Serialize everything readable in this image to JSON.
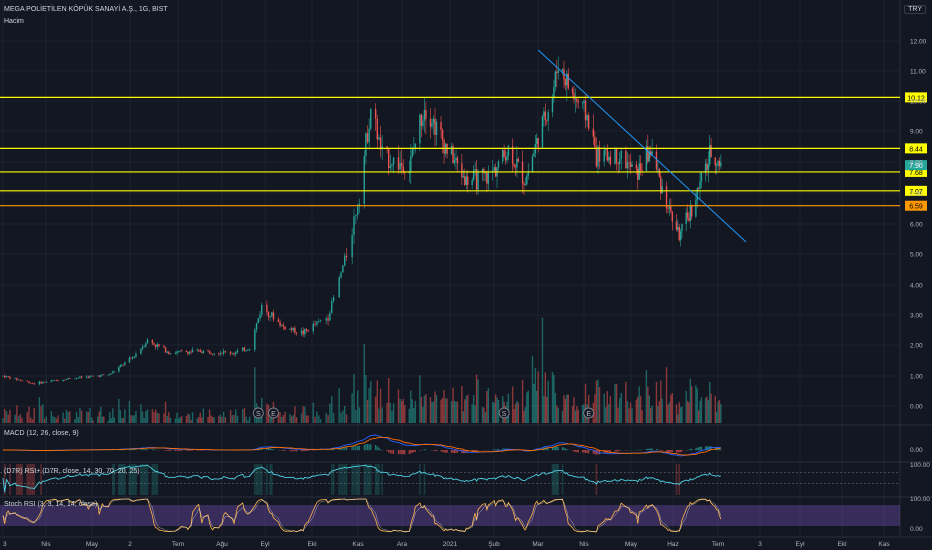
{
  "header": {
    "title": "MEGA POLİETİLEN KÖPÜK SANAYİ A.Ş., 1G, BIST",
    "volume_label": "Hacim",
    "currency": "TRY"
  },
  "colors": {
    "background": "#131722",
    "grid": "#1e222d",
    "up": "#26a69a",
    "down": "#ef5350",
    "level_yellow": "#ffff00",
    "level_orange": "#ff9800",
    "trendline": "#2196f3",
    "macd": "#2962ff",
    "signal": "#ff6d00",
    "stoch_k": "#ffb74d",
    "stoch_band": "#7e57c2"
  },
  "chart_data": {
    "type": "candlestick",
    "x_ticks": [
      "3",
      "Nis",
      "May",
      "2",
      "Tem",
      "Ağu",
      "Eyl",
      "Ekl",
      "Kas",
      "Ara",
      "2021",
      "Şub",
      "Mar",
      "Nis",
      "May",
      "Haz",
      "Tem",
      "3",
      "Eyl",
      "Ekl",
      "Kas"
    ],
    "y_ticks": [
      "12.00",
      "11.00",
      "10.00",
      "9.00",
      "8.00",
      "7.00",
      "6.00",
      "5.00",
      "4.00",
      "3.00",
      "2.00",
      "1.00",
      "0.00"
    ],
    "price_levels": [
      {
        "label": "10.12",
        "value": 10.12,
        "color": "#ffff00"
      },
      {
        "label": "8.44",
        "value": 8.44,
        "color": "#ffff00"
      },
      {
        "label": "7.68",
        "value": 7.68,
        "color": "#ffff00"
      },
      {
        "label": "7.07",
        "value": 7.07,
        "color": "#ffff00"
      },
      {
        "label": "6.59",
        "value": 6.59,
        "color": "#ff9800"
      }
    ],
    "last_price": {
      "label": "7.90",
      "value": 7.9
    },
    "trendline": {
      "from": {
        "date": "2021-01-29",
        "price": 11.7
      },
      "to": {
        "date": "2021-06-22",
        "price": 5.4
      }
    },
    "event_markers": [
      {
        "label": "S",
        "date": "2020-08-05"
      },
      {
        "label": "E",
        "date": "2020-08-14"
      },
      {
        "label": "S",
        "date": "2021-01-05"
      },
      {
        "label": "E",
        "date": "2021-03-05"
      }
    ],
    "price_path": [
      {
        "date": "2020-03-02",
        "price": 1.0
      },
      {
        "date": "2020-03-20",
        "price": 0.75
      },
      {
        "date": "2020-04-10",
        "price": 0.92
      },
      {
        "date": "2020-05-05",
        "price": 1.05
      },
      {
        "date": "2020-05-20",
        "price": 1.6
      },
      {
        "date": "2020-05-29",
        "price": 2.15
      },
      {
        "date": "2020-06-12",
        "price": 1.75
      },
      {
        "date": "2020-07-01",
        "price": 1.8
      },
      {
        "date": "2020-07-22",
        "price": 1.75
      },
      {
        "date": "2020-07-31",
        "price": 1.9
      },
      {
        "date": "2020-08-07",
        "price": 3.3
      },
      {
        "date": "2020-08-20",
        "price": 2.6
      },
      {
        "date": "2020-09-01",
        "price": 2.4
      },
      {
        "date": "2020-09-15",
        "price": 2.95
      },
      {
        "date": "2020-09-25",
        "price": 5.0
      },
      {
        "date": "2020-10-02",
        "price": 7.0
      },
      {
        "date": "2020-10-09",
        "price": 9.8
      },
      {
        "date": "2020-10-16",
        "price": 8.2
      },
      {
        "date": "2020-11-02",
        "price": 7.8
      },
      {
        "date": "2020-11-12",
        "price": 9.9
      },
      {
        "date": "2020-11-25",
        "price": 8.6
      },
      {
        "date": "2020-12-10",
        "price": 7.4
      },
      {
        "date": "2020-12-25",
        "price": 7.5
      },
      {
        "date": "2021-01-08",
        "price": 8.4
      },
      {
        "date": "2021-01-20",
        "price": 7.4
      },
      {
        "date": "2021-01-29",
        "price": 8.8
      },
      {
        "date": "2021-02-08",
        "price": 10.2
      },
      {
        "date": "2021-02-12",
        "price": 11.3
      },
      {
        "date": "2021-02-22",
        "price": 10.2
      },
      {
        "date": "2021-03-04",
        "price": 9.5
      },
      {
        "date": "2021-03-10",
        "price": 8.2
      },
      {
        "date": "2021-03-25",
        "price": 8.2
      },
      {
        "date": "2021-04-05",
        "price": 7.6
      },
      {
        "date": "2021-04-15",
        "price": 8.4
      },
      {
        "date": "2021-04-26",
        "price": 6.7
      },
      {
        "date": "2021-05-05",
        "price": 5.6
      },
      {
        "date": "2021-05-14",
        "price": 6.5
      },
      {
        "date": "2021-05-21",
        "price": 7.4
      },
      {
        "date": "2021-05-28",
        "price": 8.3
      },
      {
        "date": "2021-06-04",
        "price": 7.9
      }
    ],
    "volume_ticks": [
      "3.00",
      "2.00",
      "1.00",
      "0.00"
    ],
    "indicators": [
      {
        "name": "MACD (12, 26, close, 9)",
        "y_ticks": [
          "0.00"
        ]
      },
      {
        "name": "(D7R) RSI+ (D7R, close, 14, 30, 70, 20, 25)",
        "y_ticks": [
          "100.00"
        ]
      },
      {
        "name": "Stoch RSI (3, 3, 14, 14, close)",
        "y_ticks": [
          "100.00",
          "0.00"
        ]
      }
    ]
  }
}
